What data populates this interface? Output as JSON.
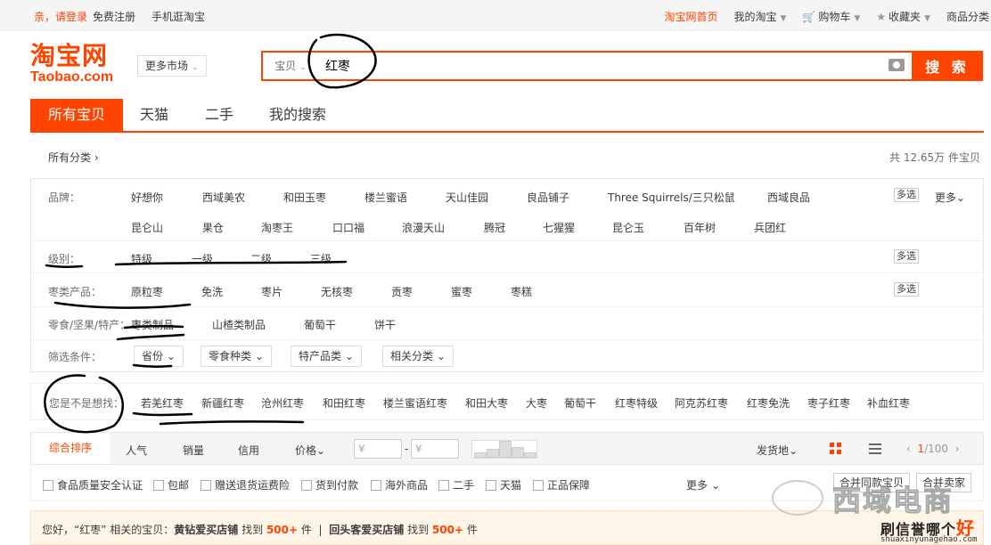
{
  "topbar": {
    "login": "亲，请登录",
    "register": "免费注册",
    "mobile": "手机逛淘宝",
    "home": "淘宝网首页",
    "my_taobao": "我的淘宝",
    "cart": "购物车",
    "favorites": "收藏夹",
    "more": "商品分类"
  },
  "header": {
    "logo_cn": "淘宝网",
    "logo_en": "Taobao.com",
    "more_market": "更多市场"
  },
  "search": {
    "type": "宝贝",
    "query": "红枣",
    "button": "搜 索"
  },
  "tabs": [
    "所有宝贝",
    "天猫",
    "二手",
    "我的搜索"
  ],
  "crumb": "所有分类",
  "total": "共 12.65万 件宝贝",
  "filters": {
    "brand_label": "品牌：",
    "brands_row1": [
      "好想你",
      "西域美农",
      "和田玉枣",
      "楼兰蜜语",
      "天山佳园",
      "良品铺子",
      "Three Squirrels/三只松鼠",
      "西域良品"
    ],
    "brands_row2": [
      "昆仑山",
      "果仓",
      "淘枣王",
      "口口福",
      "浪漫天山",
      "腾冠",
      "七猩猩",
      "昆仑玉",
      "百年树",
      "兵团红"
    ],
    "multi": "多选",
    "more": "更多",
    "grade_label": "级别：",
    "grades": [
      "特级",
      "一级",
      "二级",
      "三级"
    ],
    "product_label": "枣类产品：",
    "products": [
      "原粒枣",
      "免洗",
      "枣片",
      "无核枣",
      "贡枣",
      "蜜枣",
      "枣糕"
    ],
    "snack_label": "零食/坚果/特产：",
    "snacks": [
      "枣类制品",
      "山楂类制品",
      "葡萄干",
      "饼干"
    ],
    "cond_label": "筛选条件：",
    "conds": [
      "省份",
      "零食种类",
      "特产品类",
      "相关分类"
    ]
  },
  "suggest": {
    "label": "您是不是想找：",
    "items": [
      "若羌红枣",
      "新疆红枣",
      "沧州红枣",
      "和田红枣",
      "楼兰蜜语红枣",
      "和田大枣",
      "大枣",
      "葡萄干",
      "红枣特级",
      "阿克苏红枣",
      "红枣免洗",
      "枣子红枣",
      "补血红枣"
    ]
  },
  "sort": {
    "items": [
      "综合排序",
      "人气",
      "销量",
      "信用",
      "价格"
    ],
    "price_ph": "¥",
    "dash": "-",
    "ship": "发货地",
    "page_cur": "1",
    "page_total": "/100"
  },
  "services": {
    "items": [
      "食品质量安全认证",
      "包邮",
      "赠送退货运费险",
      "货到付款",
      "海外商品",
      "二手",
      "天猫",
      "正品保障"
    ],
    "more": "更多",
    "merge": "合并同款宝贝",
    "compare": "合并卖家"
  },
  "tip": {
    "p1": "您好，“红枣” 相关的宝贝：",
    "shop1": "黄钻爱买店铺",
    "found": "找到",
    "count1": "500+",
    "unit": "件",
    "sep": "|",
    "shop2": "回头客爱买店铺",
    "count2": "500+"
  },
  "watermark": {
    "name": "西域电商",
    "brand": "刷信誉哪个",
    "hao": "好",
    "url": "shuaxinyunagehao.com"
  }
}
